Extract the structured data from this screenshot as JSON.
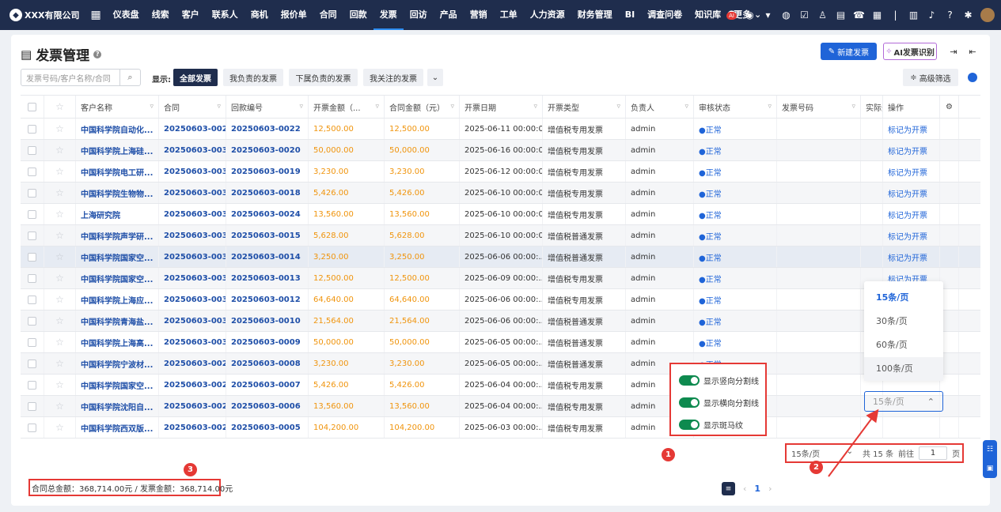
{
  "topbar": {
    "brand": "XXX有限公司",
    "nav": [
      "仪表盘",
      "线索",
      "客户",
      "联系人",
      "商机",
      "报价单",
      "合同",
      "回款",
      "发票",
      "回访",
      "产品",
      "营销",
      "工单",
      "人力资源",
      "财务管理",
      "BI",
      "调查问卷",
      "知识库",
      "更多"
    ],
    "active_nav": "发票",
    "ai_badge": "AI"
  },
  "page": {
    "title": "发票管理",
    "new_button": "新建发票",
    "ai_button": "AI发票识别",
    "search_placeholder": "发票号码/客户名称/合同",
    "show_label": "显示:",
    "filters": [
      "全部发票",
      "我负责的发票",
      "下属负责的发票",
      "我关注的发票"
    ],
    "advanced_filter": "高级筛选"
  },
  "table": {
    "headers": [
      "客户名称",
      "合同",
      "回款编号",
      "开票金额（...",
      "合同金额（元）",
      "开票日期",
      "开票类型",
      "负责人",
      "审核状态",
      "发票号码",
      "实际开",
      "操作"
    ],
    "rows": [
      {
        "customer": "中国科学院自动化...",
        "contract": "20250603-0024...",
        "return": "20250603-0022",
        "amount": "12,500.00",
        "contract_amount": "12,500.00",
        "date": "2025-06-11 00:00:00",
        "type": "增值税专用发票",
        "owner": "admin",
        "status": "●正常",
        "op": "标记为开票"
      },
      {
        "customer": "中国科学院上海硅...",
        "contract": "20250603-0039",
        "return": "20250603-0020",
        "amount": "50,000.00",
        "contract_amount": "50,000.00",
        "date": "2025-06-16 00:00:00",
        "type": "增值税专用发票",
        "owner": "admin",
        "status": "●正常",
        "op": "标记为开票"
      },
      {
        "customer": "中国科学院电工研...",
        "contract": "20250603-0038",
        "return": "20250603-0019",
        "amount": "3,230.00",
        "contract_amount": "3,230.00",
        "date": "2025-06-12 00:00:00",
        "type": "增值税专用发票",
        "owner": "admin",
        "status": "●正常",
        "op": "标记为开票"
      },
      {
        "customer": "中国科学院生物物...",
        "contract": "20250603-0037",
        "return": "20250603-0018",
        "amount": "5,426.00",
        "contract_amount": "5,426.00",
        "date": "2025-06-10 00:00:00",
        "type": "增值税专用发票",
        "owner": "admin",
        "status": "●正常",
        "op": "标记为开票"
      },
      {
        "customer": "上海研究院",
        "contract": "20250603-0036",
        "return": "20250603-0024",
        "amount": "13,560.00",
        "contract_amount": "13,560.00",
        "date": "2025-06-10 00:00:00",
        "type": "增值税专用发票",
        "owner": "admin",
        "status": "●正常",
        "op": "标记为开票"
      },
      {
        "customer": "中国科学院声学研...",
        "contract": "20250603-0035",
        "return": "20250603-0015",
        "amount": "5,628.00",
        "contract_amount": "5,628.00",
        "date": "2025-06-10 00:00:00",
        "type": "增值税普通发票",
        "owner": "admin",
        "status": "●正常",
        "op": "标记为开票"
      },
      {
        "customer": "中国科学院国家空...",
        "contract": "20250603-0034...",
        "return": "20250603-0014",
        "amount": "3,250.00",
        "contract_amount": "3,250.00",
        "date": "2025-06-06 00:00:...",
        "type": "增值税普通发票",
        "owner": "admin",
        "status": "●正常",
        "op": "标记为开票"
      },
      {
        "customer": "中国科学院国家空...",
        "contract": "20250603-0033",
        "return": "20250603-0013",
        "amount": "12,500.00",
        "contract_amount": "12,500.00",
        "date": "2025-06-09 00:00:...",
        "type": "增值税专用发票",
        "owner": "admin",
        "status": "●正常",
        "op": "标记为开票"
      },
      {
        "customer": "中国科学院上海应...",
        "contract": "20250603-0032",
        "return": "20250603-0012",
        "amount": "64,640.00",
        "contract_amount": "64,640.00",
        "date": "2025-06-06 00:00:...",
        "type": "增值税专用发票",
        "owner": "admin",
        "status": "●正常",
        "op": "标记为开票"
      },
      {
        "customer": "中国科学院青海盐...",
        "contract": "20250603-0031",
        "return": "20250603-0010",
        "amount": "21,564.00",
        "contract_amount": "21,564.00",
        "date": "2025-06-06 00:00:...",
        "type": "增值税普通发票",
        "owner": "admin",
        "status": "●正常",
        "op": ""
      },
      {
        "customer": "中国科学院上海高...",
        "contract": "20250603-0030",
        "return": "20250603-0009",
        "amount": "50,000.00",
        "contract_amount": "50,000.00",
        "date": "2025-06-05 00:00:...",
        "type": "增值税普通发票",
        "owner": "admin",
        "status": "●正常",
        "op": ""
      },
      {
        "customer": "中国科学院宁波材...",
        "contract": "20250603-0029",
        "return": "20250603-0008",
        "amount": "3,230.00",
        "contract_amount": "3,230.00",
        "date": "2025-06-05 00:00:...",
        "type": "增值税普通发票",
        "owner": "admin",
        "status": "●正常",
        "op": ""
      },
      {
        "customer": "中国科学院国家空...",
        "contract": "20250603-0028",
        "return": "20250603-0007",
        "amount": "5,426.00",
        "contract_amount": "5,426.00",
        "date": "2025-06-04 00:00:...",
        "type": "增值税专用发票",
        "owner": "admin",
        "status": "●正常",
        "op": ""
      },
      {
        "customer": "中国科学院沈阳自...",
        "contract": "20250603-0027",
        "return": "20250603-0006",
        "amount": "13,560.00",
        "contract_amount": "13,560.00",
        "date": "2025-06-04 00:00:...",
        "type": "增值税专用发票",
        "owner": "admin",
        "status": "",
        "op": ""
      },
      {
        "customer": "中国科学院西双版...",
        "contract": "20250603-0026",
        "return": "20250603-0005",
        "amount": "104,200.00",
        "contract_amount": "104,200.00",
        "date": "2025-06-03 00:00:...",
        "type": "增值税专用发票",
        "owner": "admin",
        "status": "",
        "op": ""
      }
    ]
  },
  "page_sizes": {
    "options": [
      "15条/页",
      "30条/页",
      "60条/页",
      "100条/页"
    ],
    "selected": "15条/页"
  },
  "toggles": [
    "显示竖向分割线",
    "显示横向分割线",
    "显示斑马纹"
  ],
  "summary": "合同总金额：368,714.00元 / 发票金额：368,714.00元",
  "pagination": {
    "current_page": "1",
    "page_size": "15条/页",
    "total": "共 15 条",
    "goto_label": "前往",
    "goto_value": "1",
    "page_suffix": "页"
  },
  "callouts": [
    "1",
    "2",
    "3"
  ],
  "colors": {
    "nav_bg": "#1f2d4d",
    "primary": "#1f64d8",
    "amount": "#f0940c",
    "highlight": "#e53935",
    "switch": "#0e8a4f"
  }
}
